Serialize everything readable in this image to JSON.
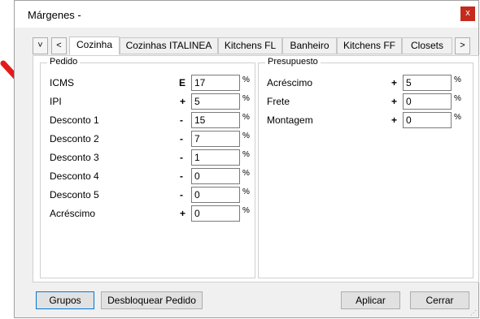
{
  "window": {
    "title": "Márgenes -",
    "close_label": "x"
  },
  "nav": {
    "down_label": "˅",
    "left_label": "<",
    "right_label": ">"
  },
  "tabs": [
    {
      "label": "Cozinha",
      "active": true
    },
    {
      "label": "Cozinhas ITALINEA"
    },
    {
      "label": "Kitchens FL"
    },
    {
      "label": "Banheiro"
    },
    {
      "label": "Kitchens FF"
    },
    {
      "label": "Closets"
    }
  ],
  "pedido": {
    "title": "Pedido",
    "rows": [
      {
        "label": "ICMS",
        "sign": "E",
        "value": "17",
        "unit": "%"
      },
      {
        "label": "IPI",
        "sign": "+",
        "value": "5",
        "unit": "%"
      },
      {
        "label": "Desconto 1",
        "sign": "-",
        "value": "15",
        "unit": "%"
      },
      {
        "label": "Desconto 2",
        "sign": "-",
        "value": "7",
        "unit": "%"
      },
      {
        "label": "Desconto 3",
        "sign": "-",
        "value": "1",
        "unit": "%"
      },
      {
        "label": "Desconto 4",
        "sign": "-",
        "value": "0",
        "unit": "%"
      },
      {
        "label": "Desconto 5",
        "sign": "-",
        "value": "0",
        "unit": "%"
      },
      {
        "label": "Acréscimo",
        "sign": "+",
        "value": "0",
        "unit": "%"
      }
    ]
  },
  "presupuesto": {
    "title": "Presupuesto",
    "rows": [
      {
        "label": "Acréscimo",
        "sign": "+",
        "value": "5",
        "unit": "%"
      },
      {
        "label": "Frete",
        "sign": "+",
        "value": "0",
        "unit": "%"
      },
      {
        "label": "Montagem",
        "sign": "+",
        "value": "0",
        "unit": "%"
      }
    ]
  },
  "buttons": {
    "grupos": "Grupos",
    "desbloquear": "Desbloquear Pedido",
    "aplicar": "Aplicar",
    "cerrar": "Cerrar"
  },
  "colors": {
    "arrow": "#e31b1b",
    "close": "#c42b1c",
    "focus": "#0078d7"
  }
}
